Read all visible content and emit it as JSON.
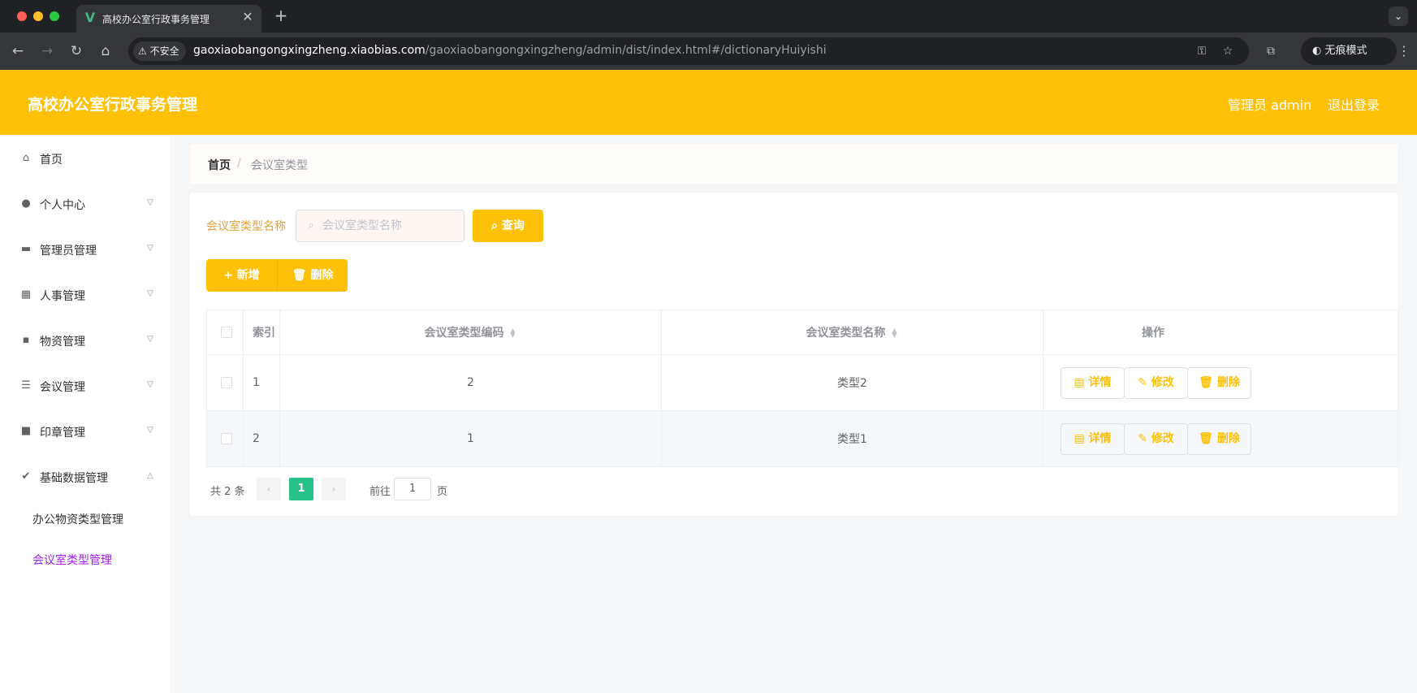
{
  "browser": {
    "tab_title": "高校办公室行政事务管理",
    "tab_close": "✕",
    "new_tab": "+",
    "favicon": "V",
    "security_label": "不安全",
    "url_host": "gaoxiaobangongxingzheng.xiaobias.com",
    "url_path": "/gaoxiaobangongxingzheng/admin/dist/index.html#/dictionaryHuiyishi",
    "incognito_label": "无痕模式",
    "icons": [
      "back-icon",
      "forward-icon",
      "reload-icon",
      "home-icon",
      "warning-icon",
      "key-icon",
      "star-icon",
      "extension-icon",
      "incognito-icon",
      "kebab-icon"
    ]
  },
  "header": {
    "title": "高校办公室行政事务管理",
    "user": "管理员 admin",
    "logout": "退出登录",
    "background": "#ffc107"
  },
  "sidebar": {
    "items": [
      {
        "label": "首页",
        "icon": "home-icon"
      },
      {
        "label": "个人中心",
        "icon": "user-icon"
      },
      {
        "label": "管理员管理",
        "icon": "ticket-icon"
      },
      {
        "label": "人事管理",
        "icon": "grid-icon"
      },
      {
        "label": "物资管理",
        "icon": "chat-icon"
      },
      {
        "label": "会议管理",
        "icon": "list-icon"
      },
      {
        "label": "印章管理",
        "icon": "stamp-icon"
      },
      {
        "label": "基础数据管理",
        "icon": "clipboard-icon"
      }
    ],
    "sub_items": [
      {
        "label": "办公物资类型管理"
      },
      {
        "label": "会议室类型管理",
        "active": true
      }
    ],
    "active_color": "#a020f0"
  },
  "breadcrumb": {
    "home": "首页",
    "separator": "/",
    "current": "会议室类型"
  },
  "search": {
    "label": "会议室类型名称",
    "placeholder": "会议室类型名称",
    "button": "查询"
  },
  "actions": {
    "add": "新增",
    "delete": "删除"
  },
  "table": {
    "columns": [
      "索引",
      "会议室类型编码",
      "会议室类型名称",
      "操作"
    ],
    "rows": [
      {
        "index": "1",
        "code": "2",
        "name": "类型2"
      },
      {
        "index": "2",
        "code": "1",
        "name": "类型1"
      }
    ],
    "row_actions": {
      "detail": "详情",
      "edit": "修改",
      "delete": "删除"
    }
  },
  "pagination": {
    "total": "共 2 条",
    "prev": "‹",
    "next": "›",
    "current_page": "1",
    "goto_label": "前往",
    "goto_value": "1",
    "page_suffix": "页",
    "active_color": "#27c28a"
  }
}
